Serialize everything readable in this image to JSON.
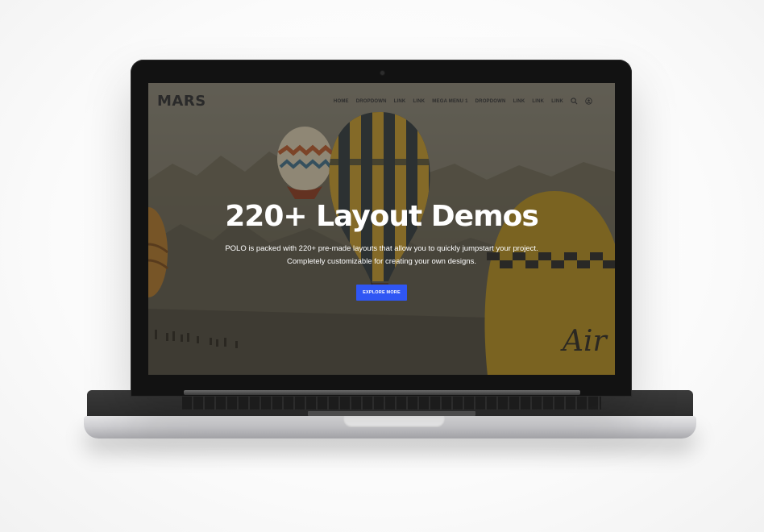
{
  "site": {
    "logo": "MARS"
  },
  "nav": {
    "items": [
      {
        "label": "HOME"
      },
      {
        "label": "DROPDOWN"
      },
      {
        "label": "LINK"
      },
      {
        "label": "LINK"
      },
      {
        "label": "MEGA MENU 1"
      },
      {
        "label": "DROPDOWN"
      },
      {
        "label": "LINK"
      },
      {
        "label": "LINK"
      },
      {
        "label": "LINK"
      }
    ],
    "icons": [
      "search-icon",
      "user-icon"
    ]
  },
  "hero": {
    "title": "220+ Layout Demos",
    "description": "POLO is packed with 220+ pre-made layouts that allow you to quickly jumpstart your project. Completely customizable for creating your own designs.",
    "button_label": "EXPLORE MORE",
    "button_color": "#2f56f4"
  },
  "device": {
    "icon": "laptop-mockup"
  }
}
